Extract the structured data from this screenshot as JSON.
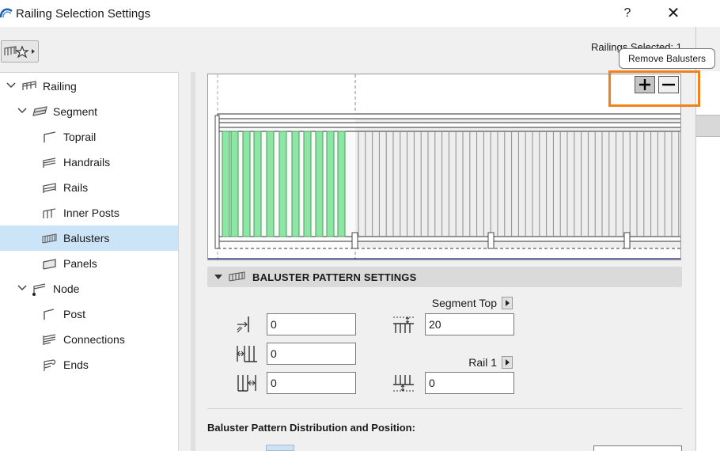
{
  "window": {
    "title": "Railing Selection Settings",
    "help_label": "?",
    "close_label": "✕"
  },
  "header": {
    "selected_count": "Railings Selected: 1"
  },
  "tooltip": {
    "text": "Remove Balusters"
  },
  "tree": {
    "items": [
      {
        "label": "Railing",
        "icon": "railing-icon",
        "level": 0,
        "expanded": true
      },
      {
        "label": "Segment",
        "icon": "segment-icon",
        "level": 1,
        "expanded": true
      },
      {
        "label": "Toprail",
        "icon": "toprail-icon",
        "level": 2
      },
      {
        "label": "Handrails",
        "icon": "handrails-icon",
        "level": 2
      },
      {
        "label": "Rails",
        "icon": "rails-icon",
        "level": 2
      },
      {
        "label": "Inner Posts",
        "icon": "inner-posts-icon",
        "level": 2
      },
      {
        "label": "Balusters",
        "icon": "balusters-icon",
        "level": 2,
        "selected": true
      },
      {
        "label": "Panels",
        "icon": "panels-icon",
        "level": 2
      },
      {
        "label": "Node",
        "icon": "node-icon",
        "level": 1,
        "expanded": true
      },
      {
        "label": "Post",
        "icon": "post-icon",
        "level": 2
      },
      {
        "label": "Connections",
        "icon": "connections-icon",
        "level": 2
      },
      {
        "label": "Ends",
        "icon": "ends-icon",
        "level": 2
      }
    ]
  },
  "preview": {
    "add_label": "+",
    "remove_label": "−",
    "accent_color": "#f0821e",
    "baluster_selected_color": "#8ee6a4"
  },
  "baluster_pattern": {
    "section_title": "BALUSTER PATTERN SETTINGS",
    "fields": {
      "left_offset": "0",
      "pattern_length": "0",
      "right_offset": "0",
      "top_offset": "20",
      "bottom_offset": "0"
    },
    "top_reference": "Segment Top",
    "bottom_reference": "Rail 1"
  },
  "distribution": {
    "label": "Baluster Pattern Distribution and Position:"
  }
}
